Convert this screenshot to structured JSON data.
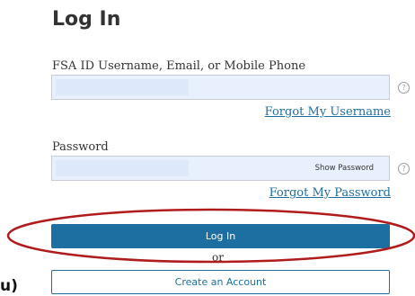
{
  "login": {
    "title": "Log In",
    "username_label": "FSA ID Username, Email, or Mobile Phone",
    "username_value": "",
    "forgot_username": "Forgot My Username",
    "password_label": "Password",
    "password_value": "",
    "show_password": "Show Password",
    "forgot_password": "Forgot My Password",
    "login_button": "Log In",
    "or": "or",
    "create_account": "Create an Account",
    "help_glyph": "?"
  },
  "annotation": {
    "edge_text": "u)",
    "highlight_color": "#b01c1c"
  },
  "colors": {
    "primary": "#1e6fa1",
    "link": "#1f6ea0",
    "input_fill": "#e8f0fe",
    "text": "#333333"
  },
  "icons": {
    "help": "question-circle-icon"
  }
}
